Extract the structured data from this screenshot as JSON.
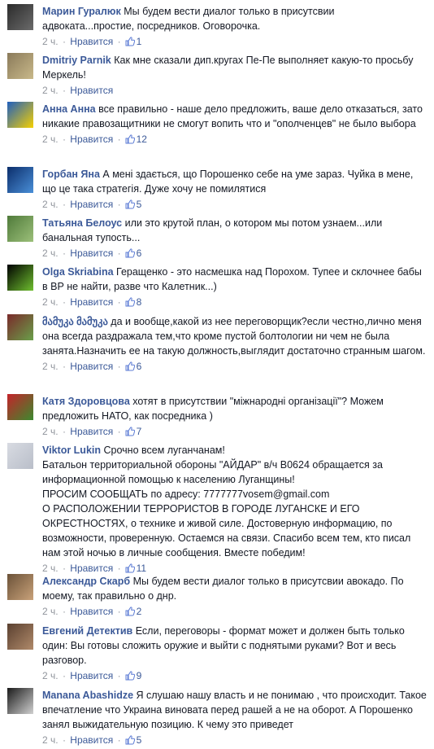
{
  "labels": {
    "like": "Нравится",
    "sep": "·"
  },
  "comments": [
    {
      "author": "Марин Гуралюк",
      "text": "Мы будем вести диалог только в присутсвии адвоката...простие, посредников. Оговорочка.",
      "time": "2 ч.",
      "likes": "1",
      "avatar": [
        "#2b2b2b",
        "#6b6b6b"
      ]
    },
    {
      "author": "Dmitriy Parnik",
      "text": "Как мне сказали дип.кругах Пе-Пе выполняет какую-то просьбу Меркель!",
      "time": "2 ч.",
      "likes": "",
      "avatar": [
        "#8a7a5a",
        "#c9b98a"
      ]
    },
    {
      "author": "Анна Анна",
      "text": "все правильно - наше дело предложить, ваше дело отказаться, зато никакие правозащитники не смогут вопить что и \"ополченцев\" не было выбора",
      "time": "2 ч.",
      "likes": "12",
      "avatar": [
        "#1f5fbf",
        "#f5d000"
      ]
    },
    {
      "author": "Горбан Яна",
      "text": "А мені здається, що Порошенко себе на уме зараз. Чуйка в мене, що це така стратегія. Дуже хочу не помилятися",
      "time": "2 ч.",
      "likes": "5",
      "avatar": [
        "#0b2e6b",
        "#4a8fd8"
      ]
    },
    {
      "author": "Татьяна Белоус",
      "text": "или это крутой план, о котором мы потом узнаем...или банальная тупость...",
      "time": "2 ч.",
      "likes": "6",
      "avatar": [
        "#4f7a3a",
        "#9cc07a"
      ]
    },
    {
      "author": "Olga Skriabina",
      "text": "Геращенко - это насмешка над Порохом. Тупее и склочнее бабы в ВР не найти, разве что Калетник...)",
      "time": "2 ч.",
      "likes": "8",
      "avatar": [
        "#000000",
        "#6fbf2f"
      ]
    },
    {
      "author": "მამუკა მამუკა",
      "text": "да и вообще,какой из нее переговорщик?если честно,лично меня она всегда раздражала тем,что кроме пустой болтологии ни чем не была занята.Назначить ее на такую должность,выглядит достаточно странным шагом.",
      "time": "2 ч.",
      "likes": "6",
      "avatar": [
        "#7a2a2a",
        "#6aa04a"
      ]
    },
    {
      "author": "Катя Здоровцова",
      "text": "хотят в присутствии \"міжнародні організації\"? Можем предложить НАТО, как посредника )",
      "time": "2 ч.",
      "likes": "7",
      "avatar": [
        "#c4232a",
        "#3c8a2e"
      ]
    },
    {
      "author": "Viktor Lukin",
      "text": "Срочно всем луганчанам!\nБатальон территориальной обороны \"АЙДАР\" в/ч В0624 обращается за информационной помощью к населению Луганщины!\nПРОСИМ СООБЩАТЬ по адресу: 7777777vosem@gmail.com\nО РАСПОЛОЖЕНИИ ТЕРРОРИСТОВ В ГОРОДЕ ЛУГАНСКЕ И ЕГО ОКРЕСТНОСТЯХ, о технике и живой силе. Достоверную информацию, по возможности, проверенную. Остаемся на связи. Спасибо всем тем, кто писал нам этой ночью в личные сообщения. Вместе победим!",
      "time": "2 ч.",
      "likes": "11",
      "avatar": [
        "#d8dbe2",
        "#b9bec9"
      ]
    },
    {
      "author": "Александр Скарб",
      "text": "Мы будем вести диалог только в присутсвии авокадо. По моему, так правильно о днр.",
      "time": "2 ч.",
      "likes": "2",
      "avatar": [
        "#6b5238",
        "#c9a27a"
      ]
    },
    {
      "author": "Евгений Детектив",
      "text": "Если, переговоры - формат может и должен быть только один: Вы готовы сложить оружие и выйти с поднятыми руками? Вот и весь разговор.",
      "time": "2 ч.",
      "likes": "9",
      "avatar": [
        "#5a4030",
        "#b08a6a"
      ]
    },
    {
      "author": "Manana Abashidze",
      "text": "Я слушаю нашу власть и не понимаю , что происходит. Такое впечатление что Украина виновата перед рашей а не на оборот. А Порошенко занял выжидательную позицию. К чему это приведет",
      "time": "2 ч.",
      "likes": "5",
      "avatar": [
        "#1a1a1a",
        "#d0d0d0"
      ]
    }
  ]
}
